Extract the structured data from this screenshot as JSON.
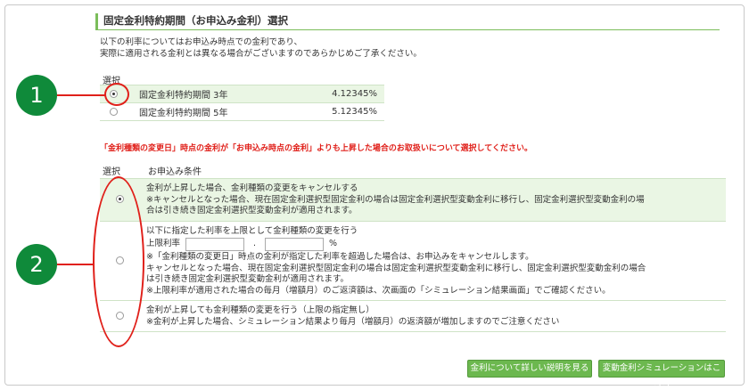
{
  "section": {
    "title": "固定金利特約期間（お申込み金利）選択",
    "notice_line1": "以下の利率についてはお申込み時点での金利であり、",
    "notice_line2": "実際に適用される金利とは異なる場合がございますのであらかじめご了承ください。"
  },
  "rates": {
    "header_select": "選択",
    "items": [
      {
        "name": "固定金利特約期間 3年",
        "value": "4.12345%",
        "selected": true
      },
      {
        "name": "固定金利特約期間 5年",
        "value": "5.12345%",
        "selected": false
      }
    ]
  },
  "warning": "「金利種類の変更日」時点の金利が「お申込み時点の金利」よりも上昇した場合のお取扱いについて選択してください。",
  "conditions": {
    "header_select": "選択",
    "header_conditions": "お申込み条件",
    "option1": {
      "selected": true,
      "line1": "金利が上昇した場合、金利種類の変更をキャンセルする",
      "line2": "※キャンセルとなった場合、現在固定金利選択型固定金利の場合は固定金利選択型変動金利に移行し、固定金利選択型変動金利の場",
      "line3": "合は引き続き固定金利選択型変動金利が適用されます。"
    },
    "option2": {
      "selected": false,
      "line1": "以下に指定した利率を上限として金利種類の変更を行う",
      "rate_label": "上限利率",
      "decimal_point": ".",
      "percent": "%",
      "line2": "※「金利種類の変更日」時点の金利が指定した利率を超過した場合は、お申込みをキャンセルします。",
      "line3": "キャンセルとなった場合、現在固定金利選択型固定金利の場合は固定金利選択型変動金利に移行し、固定金利選択型変動金利の場合",
      "line4": "は引き続き固定金利選択型変動金利が適用されます。",
      "line5": "※上限利率が適用された場合の毎月（増額月）のご返済額は、次画面の「シミュレーション結果画面」でご確認ください。"
    },
    "option3": {
      "selected": false,
      "line1": "金利が上昇しても金利種類の変更を行う（上限の指定無し）",
      "line2": "※金利が上昇した場合、シミュレーション結果より毎月（増額月）の返済額が増加しますのでご注意ください"
    }
  },
  "buttons": {
    "explain": "金利について詳しい説明を見る",
    "simulation": "変動金利シミュレーションはこちら"
  },
  "annotations": {
    "badge1": "1",
    "badge2": "2"
  },
  "colors": {
    "accent_green": "#6cb84f",
    "badge_green": "#0f8a3a",
    "highlight_red": "#e0201a",
    "selected_row_bg": "#eaf6e4"
  }
}
